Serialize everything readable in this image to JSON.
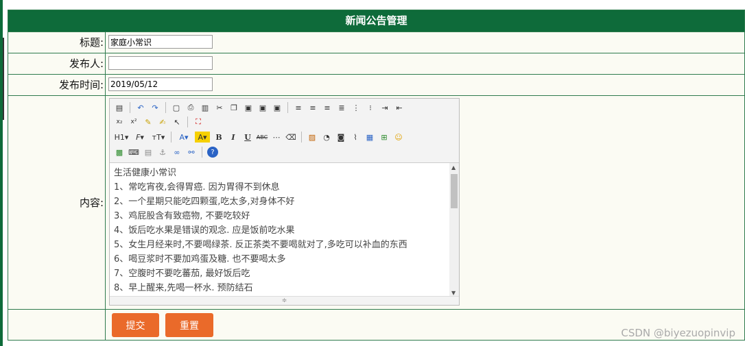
{
  "header": {
    "title": "新闻公告管理"
  },
  "form": {
    "title_label": "标题:",
    "title_value": "家庭小常识",
    "publisher_label": "发布人:",
    "publisher_value": "",
    "time_label": "发布时间:",
    "time_value": "2019/05/12",
    "content_label": "内容:"
  },
  "editor": {
    "lines": [
      "生活健康小常识",
      "1、常吃宵夜,会得胃癌. 因为胃得不到休息",
      "2、一个星期只能吃四颗蛋,吃太多,对身体不好",
      "3、鸡屁股含有致癌物, 不要吃较好",
      "4、饭后吃水果是错误的观念. 应是饭前吃水果",
      "5、女生月经来时,不要喝绿茶. 反正茶类不要喝就对了,多吃可以补血的东西",
      "6、喝豆浆时不要加鸡蛋及糖. 也不要喝太多",
      "7、空腹时不要吃蕃茄, 最好饭后吃",
      "8、早上醒来,先喝一杯水. 预防结石"
    ]
  },
  "buttons": {
    "submit": "提交",
    "reset": "重置"
  },
  "watermark": "CSDN @biyezuopinvip"
}
